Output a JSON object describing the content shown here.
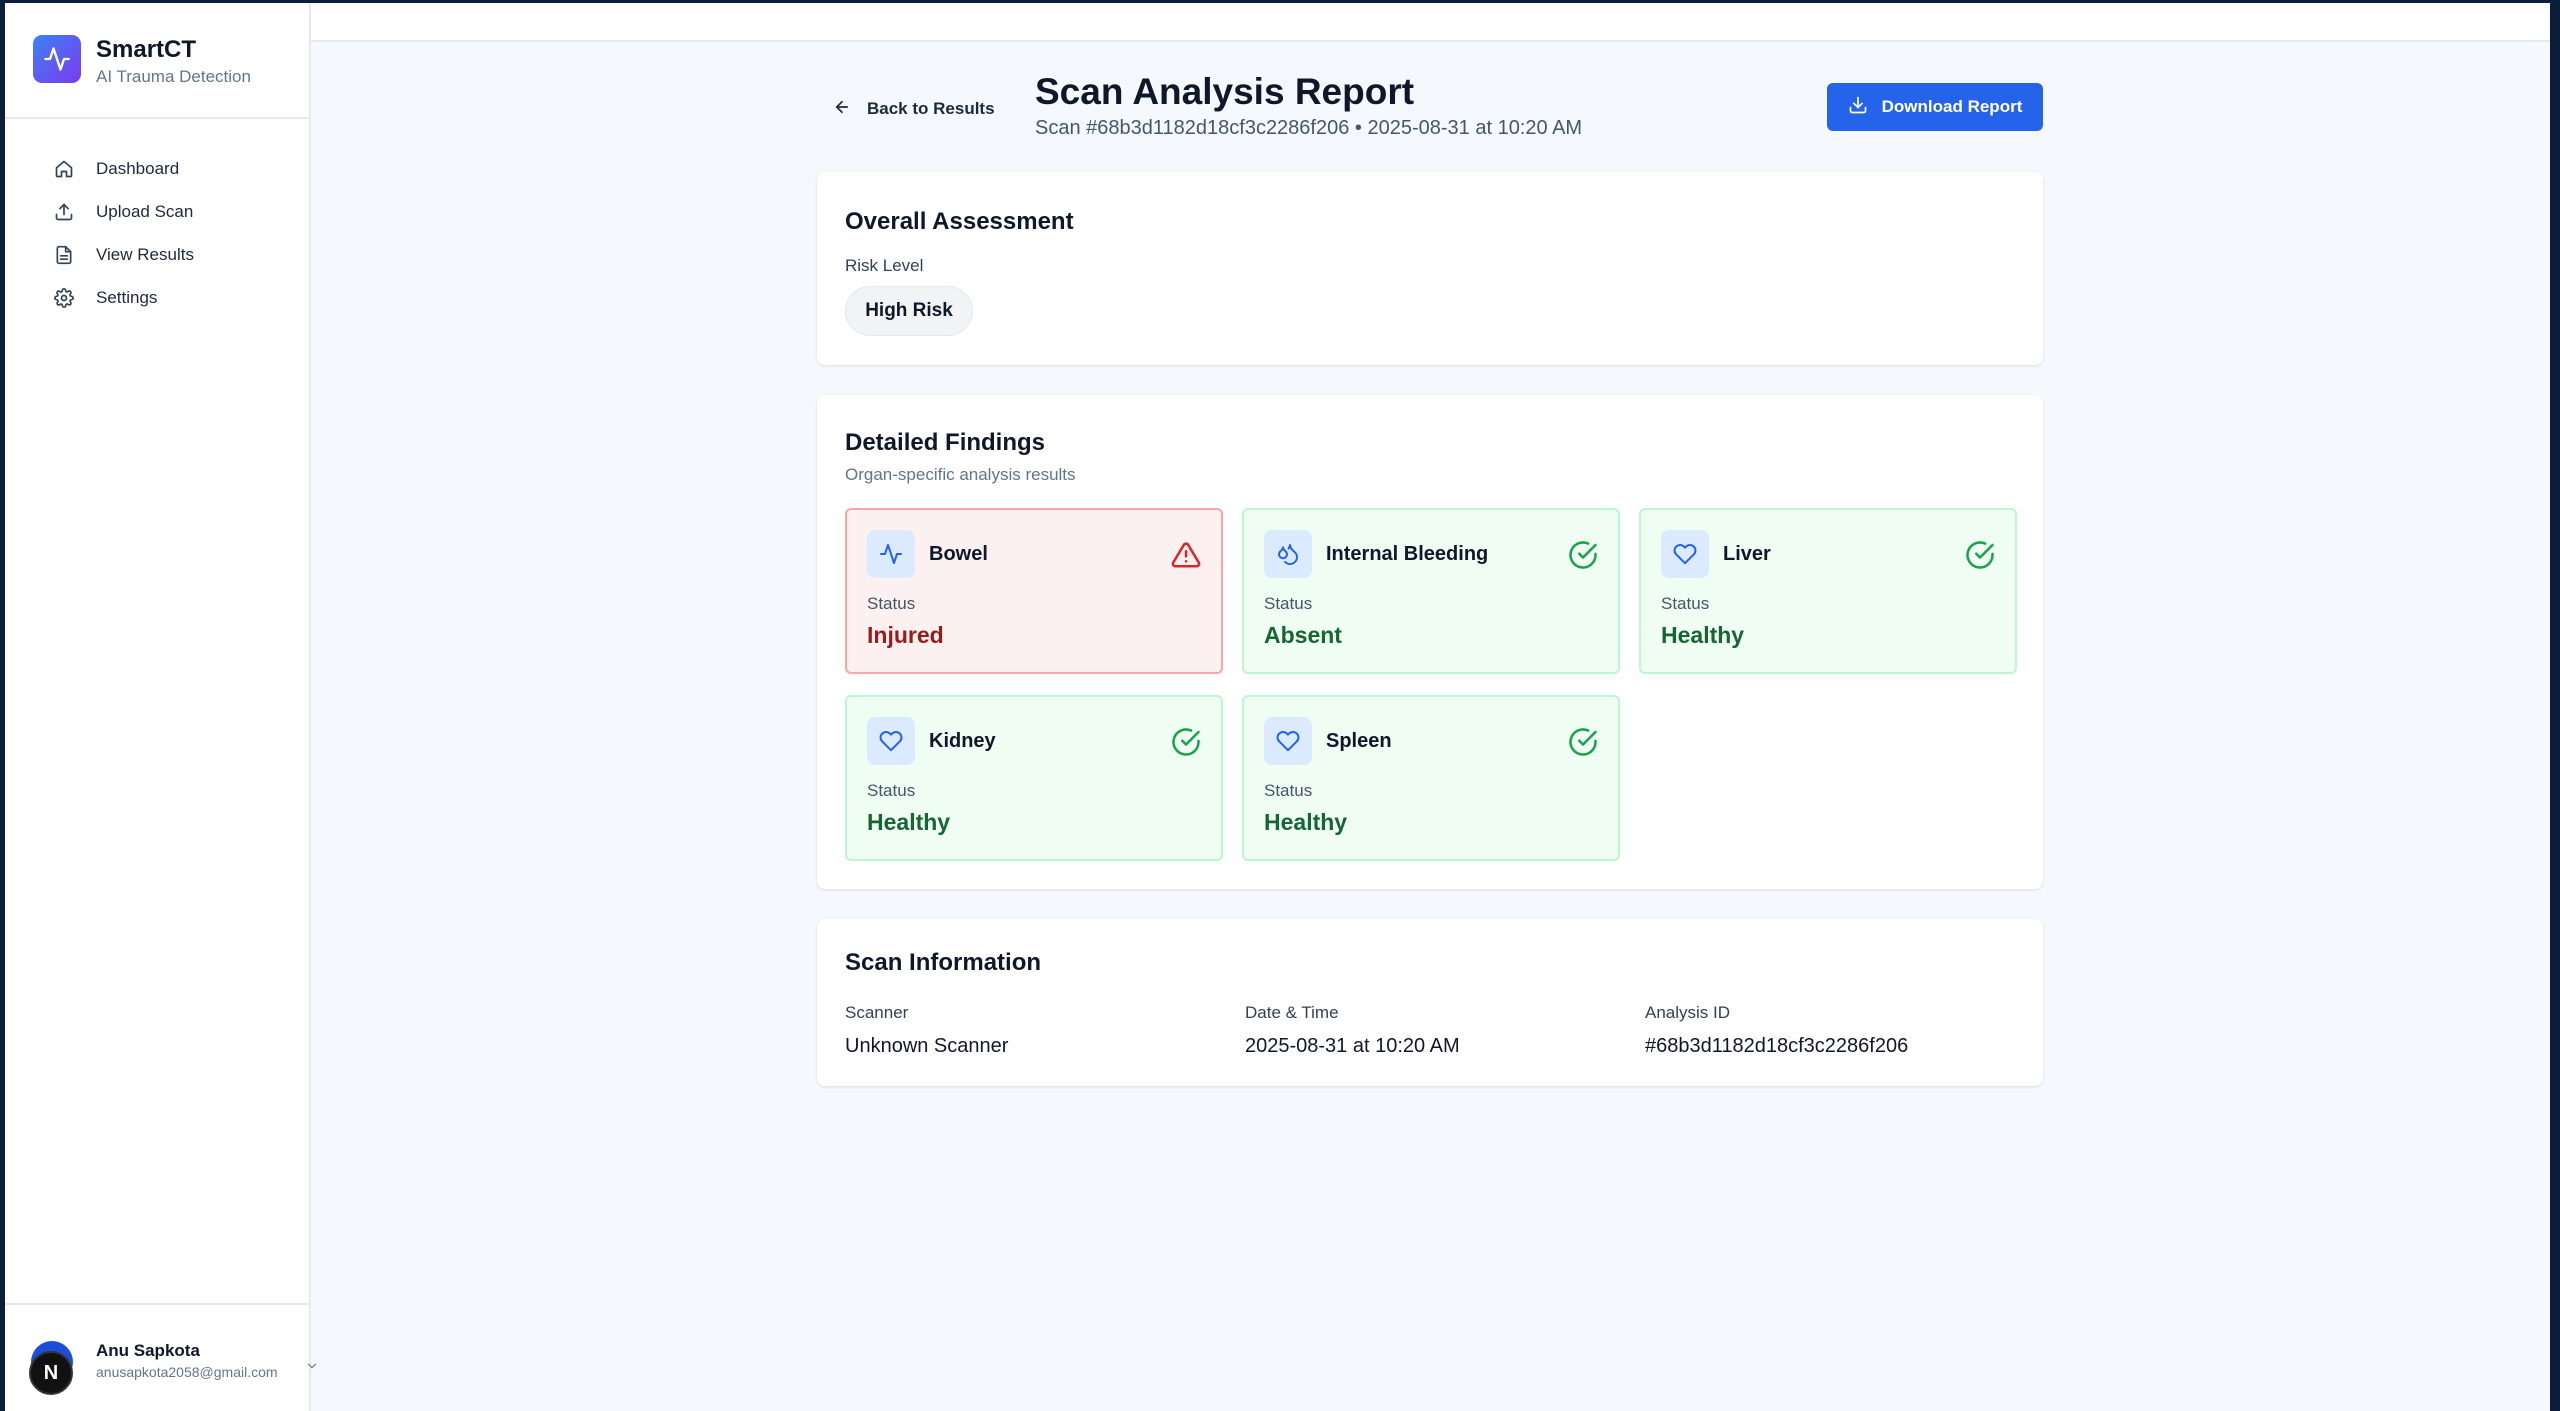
{
  "brand": {
    "name": "SmartCT",
    "subtitle": "AI Trauma Detection"
  },
  "nav": [
    {
      "label": "Dashboard",
      "icon": "home-icon"
    },
    {
      "label": "Upload Scan",
      "icon": "upload-icon"
    },
    {
      "label": "View Results",
      "icon": "file-text-icon"
    },
    {
      "label": "Settings",
      "icon": "gear-icon"
    }
  ],
  "user": {
    "name": "Anu Sapkota",
    "email": "anusapkota2058@gmail.com",
    "badge": "N"
  },
  "header": {
    "back_label": "Back to Results",
    "title": "Scan Analysis Report",
    "subtitle": "Scan #68b3d1182d18cf3c2286f206 • 2025-08-31 at 10:20 AM",
    "download_label": "Download Report"
  },
  "assessment": {
    "title": "Overall Assessment",
    "risk_label": "Risk Level",
    "risk_value": "High Risk"
  },
  "findings": {
    "title": "Detailed Findings",
    "description": "Organ-specific analysis results",
    "status_label": "Status",
    "items": [
      {
        "name": "Bowel",
        "status": "Injured",
        "state": "injured",
        "icon": "activity-icon",
        "status_icon": "alert-triangle-icon"
      },
      {
        "name": "Internal Bleeding",
        "status": "Absent",
        "state": "ok",
        "icon": "droplets-icon",
        "status_icon": "check-circle-icon"
      },
      {
        "name": "Liver",
        "status": "Healthy",
        "state": "ok",
        "icon": "heart-icon",
        "status_icon": "check-circle-icon"
      },
      {
        "name": "Kidney",
        "status": "Healthy",
        "state": "ok",
        "icon": "heart-icon",
        "status_icon": "check-circle-icon"
      },
      {
        "name": "Spleen",
        "status": "Healthy",
        "state": "ok",
        "icon": "heart-icon",
        "status_icon": "check-circle-icon"
      }
    ]
  },
  "scan_info": {
    "title": "Scan Information",
    "scanner_label": "Scanner",
    "scanner_value": "Unknown Scanner",
    "datetime_label": "Date & Time",
    "datetime_value": "2025-08-31 at 10:20 AM",
    "analysis_label": "Analysis ID",
    "analysis_value": "#68b3d1182d18cf3c2286f206"
  },
  "colors": {
    "primary": "#2563eb",
    "brand_gradient_start": "#3b82f6",
    "brand_gradient_end": "#7c3aed",
    "healthy_text": "#166534",
    "healthy_bg": "#effdf3",
    "injured_text": "#991b1b",
    "injured_bg": "#fdf0f0"
  }
}
